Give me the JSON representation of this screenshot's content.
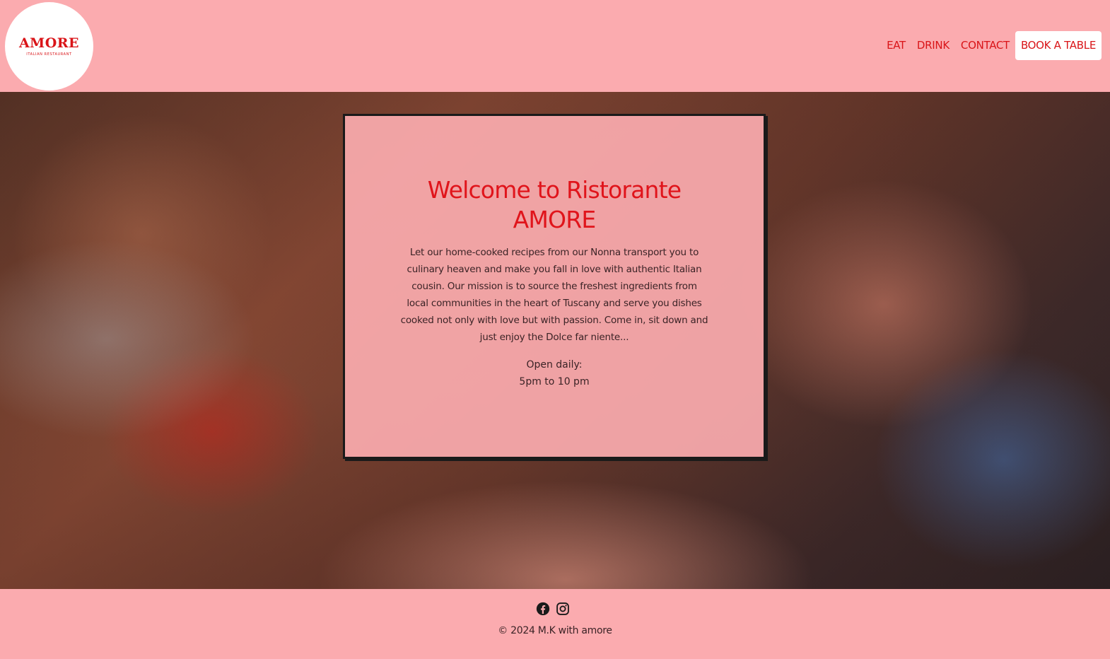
{
  "brand": {
    "name": "AMORE",
    "tagline": "ITALIAN RESTAURANT",
    "accent_color": "#d91418",
    "background_color": "#fbabaf"
  },
  "nav": {
    "items": [
      {
        "label": "EAT"
      },
      {
        "label": "DRINK"
      },
      {
        "label": "CONTACT"
      }
    ],
    "cta_label": "BOOK A TABLE"
  },
  "hero": {
    "title": "Welcome to Ristorante AMORE",
    "description": "Let our home-cooked recipes from our Nonna transport you to culinary heaven and make you fall in love with authentic Italian cousin. Our mission is to source the freshest ingredients from local communities in the heart of Tuscany and serve you dishes cooked not only with love but with passion. Come in, sit down and just enjoy the Dolce far niente...",
    "hours_label": "Open daily:",
    "hours_value": "5pm to 10 pm"
  },
  "footer": {
    "socials": [
      {
        "icon": "facebook-icon"
      },
      {
        "icon": "instagram-icon"
      }
    ],
    "copyright": "© 2024 M.K with amore"
  }
}
